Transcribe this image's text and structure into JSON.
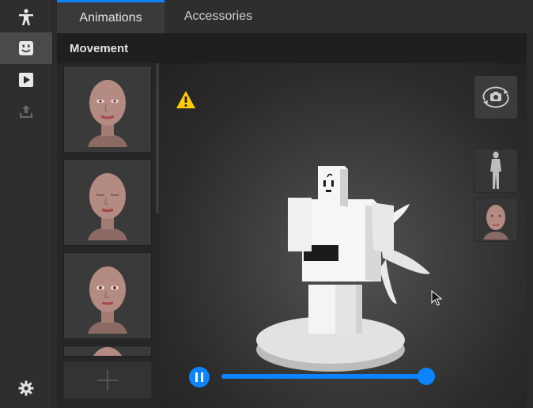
{
  "rail": {
    "items": [
      {
        "icon": "figure-icon",
        "active": false
      },
      {
        "icon": "face-icon",
        "active": true
      },
      {
        "icon": "play-icon",
        "active": false
      },
      {
        "icon": "upload-icon",
        "active": false
      }
    ],
    "settings_icon": "gear-icon"
  },
  "tabs": [
    {
      "label": "Animations",
      "active": true
    },
    {
      "label": "Accessories",
      "active": false
    }
  ],
  "section": {
    "title": "Movement"
  },
  "thumbnails": [
    {
      "icon": "face-thumbnail-icon"
    },
    {
      "icon": "face-thumbnail-icon"
    },
    {
      "icon": "face-thumbnail-icon"
    },
    {
      "icon": "face-thumbnail-icon"
    }
  ],
  "viewport": {
    "warning_icon": "warning-icon",
    "camera_button_icon": "camera-rotate-icon",
    "mode_buttons": [
      {
        "icon": "full-body-icon"
      },
      {
        "icon": "head-icon"
      }
    ]
  },
  "playback": {
    "state": "playing",
    "progress": 0.96
  },
  "colors": {
    "accent": "#0a84ff",
    "warning": "#ffcc00"
  }
}
